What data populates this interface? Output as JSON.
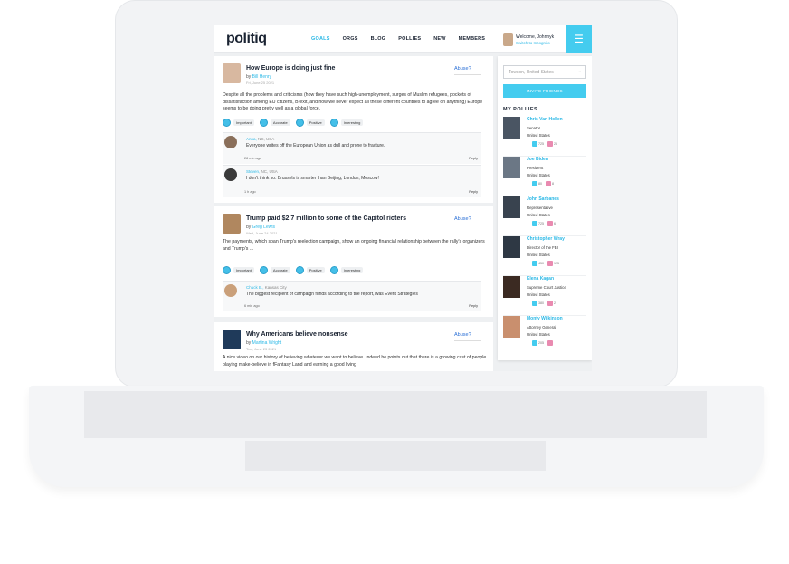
{
  "app": {
    "logo": "politiq",
    "nav": [
      "GOALS",
      "ORGS",
      "BLOG",
      "POLLIES",
      "NEW",
      "MEMBERS"
    ],
    "nav_active": "GOALS",
    "user_welcome": "Welcome, Johnnyk",
    "user_switch": "Switch to Incognito",
    "menu_icon": "hamburger-icon",
    "accent_color": "#44ccef"
  },
  "posts": [
    {
      "title": "How Europe is doing just fine",
      "by_prefix": "by",
      "author": "Bill Henry",
      "date": "Fri, June 25 2021",
      "abuse": "Abuse?",
      "body": "Despite all the problems and criticisms (how they have such high-unemployment, surges of Muslim refugees, pockets of dissatisfaction among EU citizens, Brexit, and how we never expect all these different countries to agree on anything) Europe seems to be doing pretty well as a global force.",
      "reactions": [
        "Important",
        "Accurate",
        "Positive",
        "Interesting"
      ],
      "comments": [
        {
          "author": "Anna",
          "location": "NC, USA",
          "text": "Everyone writes off the European Union as dull and prone to fracture.",
          "time": "28 min ago",
          "reply": "Reply"
        },
        {
          "author": "Steven",
          "location": "NC, USA",
          "text": "I don't think so. Brussels is smarter than Beijing, London, Moscow!",
          "time": "1 h ago",
          "reply": "Reply"
        }
      ]
    },
    {
      "title": "Trump paid $2.7 million to some of the Capitol rioters",
      "by_prefix": "by",
      "author": "Greg Lewis",
      "date": "Wed, June 24 2021",
      "abuse": "Abuse?",
      "body": "The payments, which span Trump's reelection campaign, show an ongoing financial relationship between the rally's organizers and Trump's ...",
      "reactions": [
        "Important",
        "Accurate",
        "Positive",
        "Interesting"
      ],
      "comments": [
        {
          "author": "Chuck B.",
          "location": "Kansas City",
          "text": "The biggest recipient of campaign funds according to the report, was Event Strategies",
          "time": "6 min ago",
          "reply": "Reply"
        }
      ]
    },
    {
      "title": "Why Americans believe nonsense",
      "by_prefix": "by",
      "author": "Martina Wright",
      "date": "Tue, June 23 2021",
      "abuse": "Abuse?",
      "body": "A nice video on our history of believing whatever we want to believe. Indeed he points out that there is a growing cast of people playing make-believe in fFantasy Land and earning a good living"
    }
  ],
  "sidebar": {
    "location_placeholder": "Towson, United States",
    "invite_label": "INVITE FRIENDS",
    "pollies_title": "MY POLLIES",
    "pollies": [
      {
        "name": "Chris Van Hollen",
        "role": "Senator",
        "country": "United States",
        "up": "725",
        "down": "26"
      },
      {
        "name": "Joe Biden",
        "role": "President",
        "country": "United States",
        "up": "80",
        "down": "8"
      },
      {
        "name": "John Sarbanes",
        "role": "Representative",
        "country": "United States",
        "up": "725",
        "down": "6"
      },
      {
        "name": "Christopher Wray",
        "role": "Director of the FBI",
        "country": "United States",
        "up": "450",
        "down": "125"
      },
      {
        "name": "Elena Kagan",
        "role": "Supreme Court Justice",
        "country": "United States",
        "up": "380",
        "down": "2"
      },
      {
        "name": "Monty Wilkinson",
        "role": "Attorney General",
        "country": "United States",
        "up": "205",
        "down": ""
      }
    ]
  }
}
